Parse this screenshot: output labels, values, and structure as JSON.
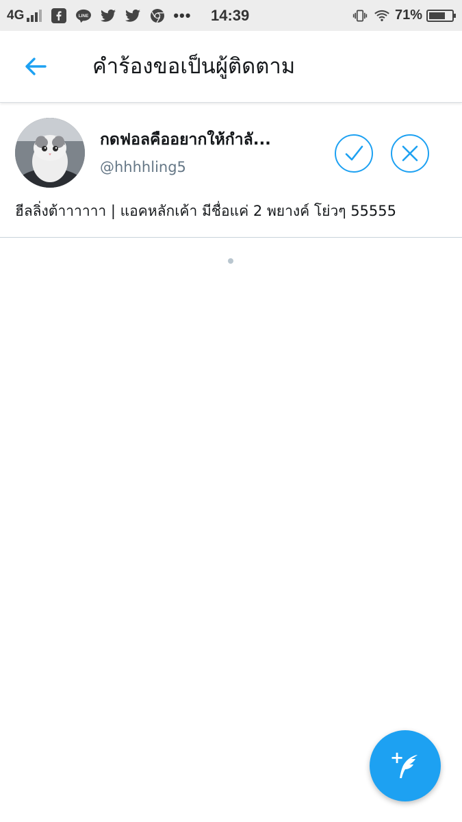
{
  "status_bar": {
    "network": "4G",
    "time": "14:39",
    "battery_percent_text": "71%",
    "battery_level": 0.71,
    "notification_icons": [
      "facebook-icon",
      "line-icon",
      "twitter-icon",
      "twitter-icon",
      "chrome-icon",
      "more-dots-icon"
    ],
    "line_label": "LINE",
    "more": "•••"
  },
  "header": {
    "title": "คำร้องขอเป็นผู้ติดตาม",
    "back_icon": "arrow-left-icon"
  },
  "request": {
    "display_name": "กดฟอลคืออยากให้กำลั...",
    "handle": "@hhhhling5",
    "bio": "ฮีลลิ่งต้าาาาาา | แอคหลักเค้า มีชื่อแค่ 2 พยางค์ โย่วๆ 55555",
    "accept_icon": "checkmark-icon",
    "decline_icon": "close-icon"
  },
  "fab": {
    "icon": "compose-tweet-icon",
    "plus": "+"
  },
  "colors": {
    "accent": "#1da1f2",
    "status_bar_bg": "#ededed",
    "secondary_text": "#657786"
  }
}
